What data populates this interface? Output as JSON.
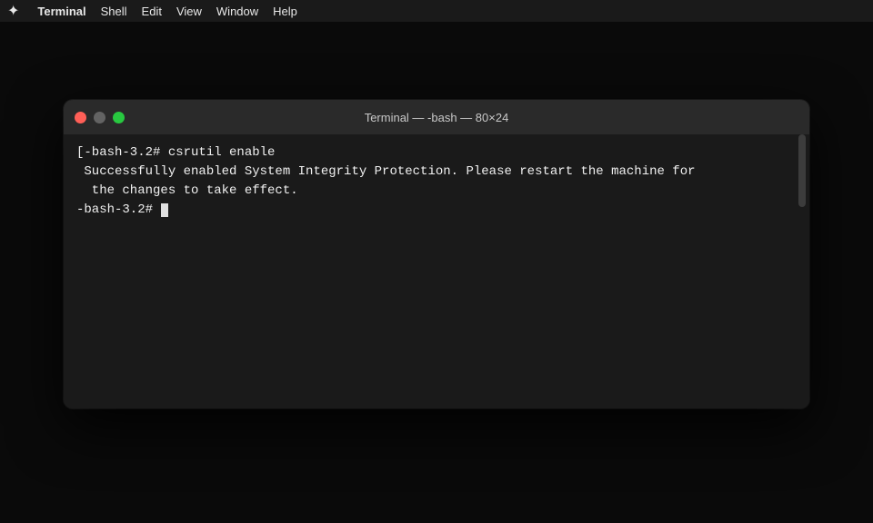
{
  "menubar": {
    "apple": "✦",
    "items": [
      "Terminal",
      "Shell",
      "Edit",
      "View",
      "Window",
      "Help"
    ]
  },
  "terminal": {
    "title": "Terminal — -bash — 80×24",
    "lines": [
      "[-bash-3.2# csrutil enable",
      " Successfully enabled System Integrity Protection. Please restart the machine for",
      "  the changes to take effect.",
      "-bash-3.2# "
    ],
    "traffic_lights": {
      "close": "close",
      "minimize": "minimize",
      "maximize": "maximize"
    }
  }
}
